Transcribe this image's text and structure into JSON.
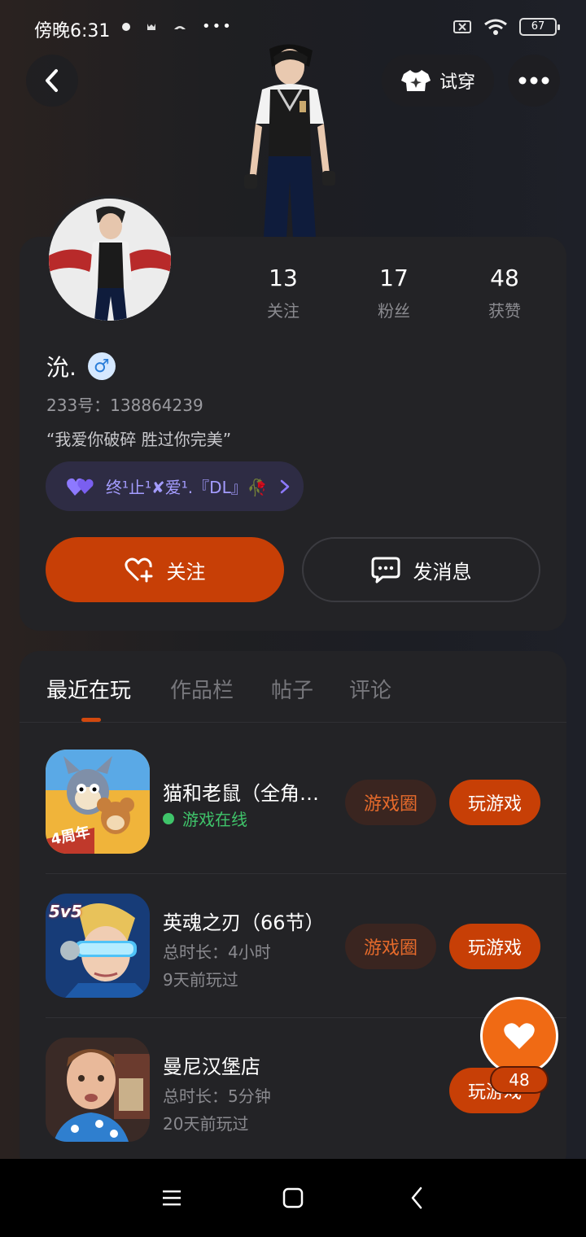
{
  "status_bar": {
    "time": "傍晚6:31",
    "battery": "67",
    "dots": "•••"
  },
  "header": {
    "try_on_label": "试穿"
  },
  "profile": {
    "stats": [
      {
        "value": "13",
        "label": "关注"
      },
      {
        "value": "17",
        "label": "粉丝"
      },
      {
        "value": "48",
        "label": "获赞"
      }
    ],
    "username": "沇.",
    "gender_symbol": "♂",
    "user_id": "233号：138864239",
    "bio": "“我爱你破碎  胜过你完美”",
    "guild": "终¹止¹✘爱¹.『DL』🥀",
    "follow_label": "关注",
    "message_label": "发消息"
  },
  "tabs": [
    {
      "label": "最近在玩"
    },
    {
      "label": "作品栏"
    },
    {
      "label": "帖子"
    },
    {
      "label": "评论"
    }
  ],
  "games": [
    {
      "name": "猫和老鼠（全角…",
      "status": "游戏在线",
      "circle_label": "游戏圈",
      "play_label": "玩游戏",
      "icon_badge": "4周年"
    },
    {
      "name": "英魂之刃（66节）",
      "duration": "总时长：4小时",
      "last_played": "9天前玩过",
      "circle_label": "游戏圈",
      "play_label": "玩游戏",
      "icon_badge": "5v5"
    },
    {
      "name": "曼尼汉堡店",
      "duration": "总时长：5分钟",
      "last_played": "20天前玩过",
      "play_label": "玩游戏"
    }
  ],
  "like_fab": {
    "count": "48"
  },
  "colors": {
    "accent": "#c73f06",
    "online": "#3fc46a",
    "guild_text": "#a49cff"
  }
}
